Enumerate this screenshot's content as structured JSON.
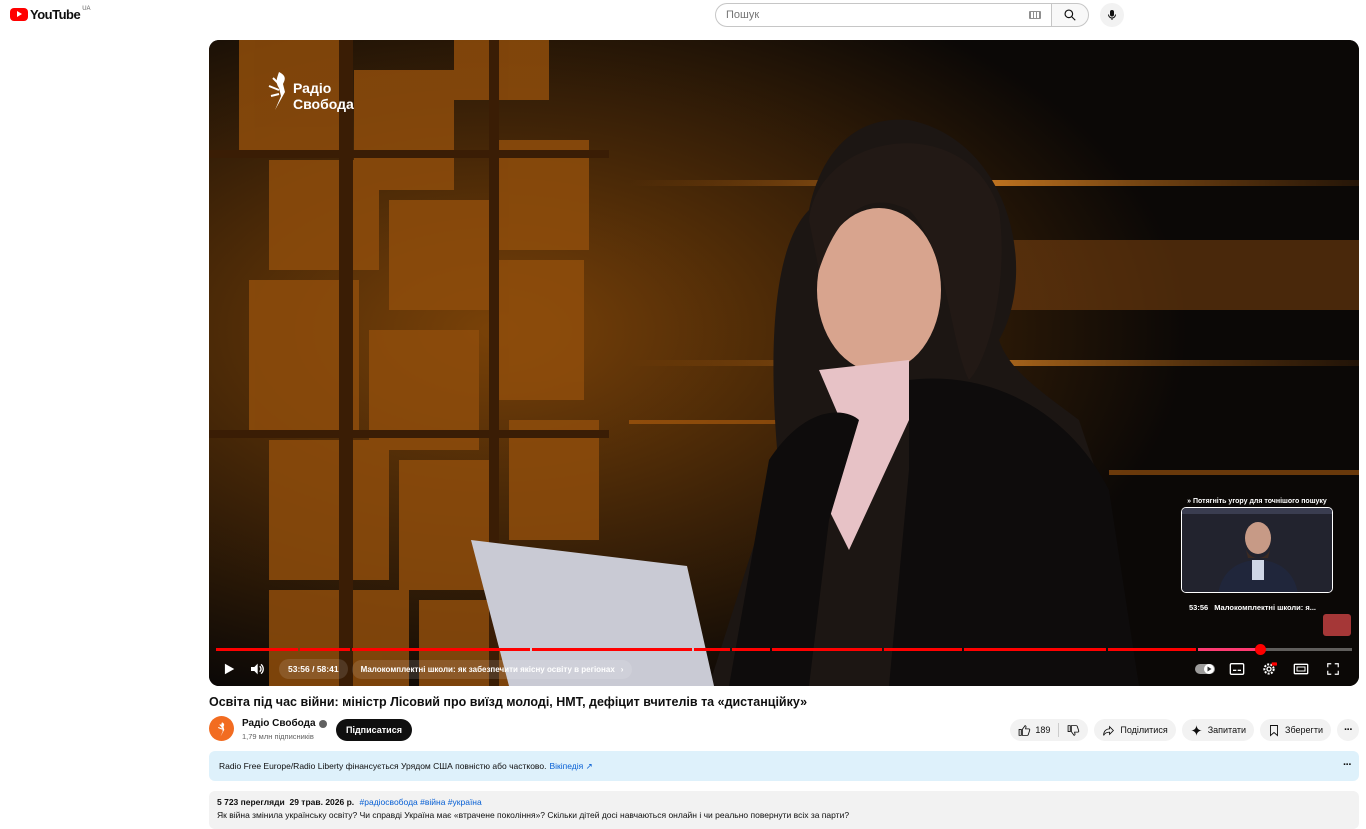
{
  "header": {
    "logo_text": "YouTube",
    "region": "UA",
    "search_placeholder": "Пошук"
  },
  "player": {
    "channel_brand": [
      "Радіо",
      "Свобода"
    ],
    "time_current": "53:56",
    "time_total": "58:41",
    "time_display": "53:56 / 58:41",
    "chapter": "Малокомплектні школи: як забезпечити якісну освіту в регіонах",
    "progress": 0.919,
    "preview": {
      "hint": "Потягніть угору для точнішого пошуку",
      "time": "53:56",
      "title": "Малокомплектні школи: я..."
    }
  },
  "video": {
    "title": "Освіта під час війни: міністр Лісовий про виїзд молоді, НМТ, дефіцит вчителів та «дистанційку»",
    "channel_name": "Радіо Свобода",
    "subscribers": "1,79 млн підписників",
    "subscribe_label": "Підписатися",
    "likes": "189",
    "share_label": "Поділитися",
    "ask_label": "Запитати",
    "save_label": "Зберегти"
  },
  "info_panel": {
    "text": "Radio Free Europe/Radio Liberty фінансується Урядом США повністю або частково.",
    "link": "Вікіпедія"
  },
  "description": {
    "views": "5 723 перегляди",
    "date": "29 трав. 2026 р.",
    "tags": "#радіосвобода #війна #україна",
    "text": "Як війна змінила українську освіту? Чи справді Україна має «втрачене покоління»? Скільки дітей досі навчаються онлайн і чи реально повернути всіх за парти?"
  },
  "colors": {
    "accent": "#ff0000",
    "link": "#065fd4",
    "banner": "#def1fb",
    "channel_avatar": "#f26c21"
  }
}
